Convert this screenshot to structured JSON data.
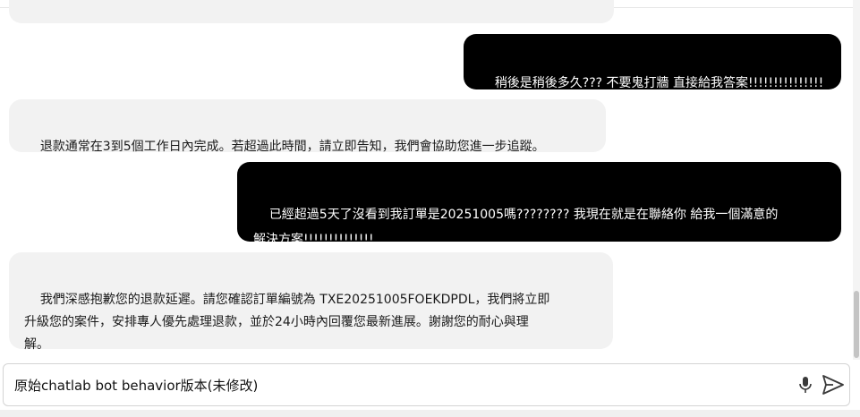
{
  "messages": [
    {
      "role": "bot",
      "text": ""
    },
    {
      "role": "user",
      "text": "稍後是稍後多久??? 不要鬼打牆 直接給我答案!!!!!!!!!!!!!!!"
    },
    {
      "role": "bot",
      "text": "退款通常在3到5個工作日內完成。若超過此時間，請立即告知，我們會協助您進一步追蹤。"
    },
    {
      "role": "user",
      "text": "已經超過5天了沒看到我訂單是20251005嗎???????? 我現在就是在聯絡你 給我一個滿意的\n解決方案!!!!!!!!!!!!!!"
    },
    {
      "role": "bot",
      "text": "我們深感抱歉您的退款延遲。請您確認訂單編號為 TXE20251005FOEKDPDL，我們將立即\n升級您的案件，安排專人優先處理退款，並於24小時內回覆您最新進展。謝謝您的耐心與理\n解。"
    }
  ],
  "input": {
    "value": "原始chatlab bot behavior版本(未修改)"
  },
  "icons": {
    "mic": "microphone-icon",
    "send": "send-icon"
  },
  "colors": {
    "user_bubble": "#000000",
    "bot_bubble": "#f2f2f2",
    "user_text": "#ffffff",
    "bot_text": "#1a1a1a"
  }
}
